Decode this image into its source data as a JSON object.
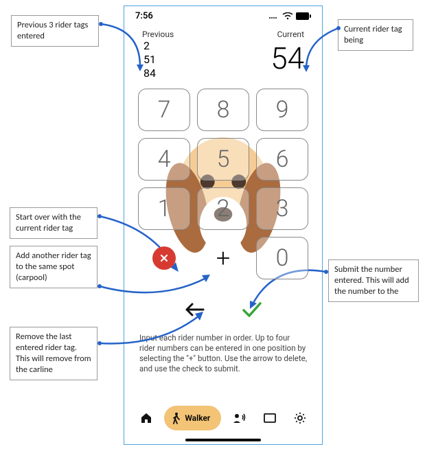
{
  "status": {
    "time": "7:56"
  },
  "numbers": {
    "previous_label": "Previous",
    "previous": [
      "2",
      "51",
      "84"
    ],
    "current_label": "Current",
    "current": "54"
  },
  "keypad": {
    "keys": [
      "7",
      "8",
      "9",
      "4",
      "5",
      "6",
      "1",
      "2",
      "3"
    ],
    "zero": "0",
    "plus": "+"
  },
  "instructions": "Input each rider number in order.  Up to four rider numbers can be entered in one position by selecting the \"+\" button.  Use the arrow to delete, and use the check to submit.",
  "nav": {
    "walker_label": "Walker"
  },
  "callouts": {
    "prev": "Previous 3 rider tags entered",
    "current": "Current rider tag being ",
    "clear": "Start over with the current rider tag",
    "plus": "Add another rider tag to the same spot (carpool)",
    "submit": "Submit the number entered.  This will add the number to the ",
    "back": "Remove the last entered rider tag.  This will remove from the carline"
  }
}
